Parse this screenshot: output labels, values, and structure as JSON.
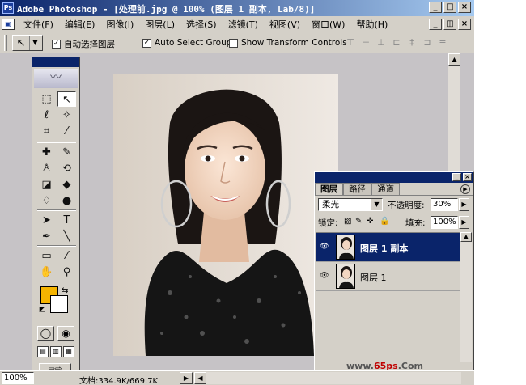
{
  "window": {
    "title": "Adobe Photoshop - [处理前.jpg @ 100% (图层 1 副本, Lab/8)]",
    "app_icon_text": "Ps"
  },
  "menu": [
    "文件(F)",
    "编辑(E)",
    "图像(I)",
    "图层(L)",
    "选择(S)",
    "滤镜(T)",
    "视图(V)",
    "窗口(W)",
    "帮助(H)"
  ],
  "options": {
    "auto_select_layer": {
      "label": "自动选择图层",
      "checked": true
    },
    "auto_select_groups": {
      "label": "Auto Select Groups",
      "checked": true
    },
    "show_transform_controls": {
      "label": "Show Transform Controls",
      "checked": false
    }
  },
  "colors": {
    "foreground": "#f5b400",
    "background": "#ffffff",
    "accent": "#0a246a"
  },
  "status": {
    "zoom": "100%",
    "doc_info": "文档:334.9K/669.7K"
  },
  "layers_panel": {
    "tabs": [
      "图层",
      "路径",
      "通道"
    ],
    "blend_mode": "柔光",
    "opacity_label": "不透明度:",
    "opacity_value": "30%",
    "lock_label": "锁定:",
    "fill_label": "填充:",
    "fill_value": "100%",
    "layers": [
      {
        "name": "图层 1 副本",
        "selected": true,
        "visible": true
      },
      {
        "name": "图层 1",
        "selected": false,
        "visible": true
      }
    ]
  },
  "watermark": {
    "prefix": "www.",
    "brand": "65ps",
    "suffix": ".Com"
  }
}
